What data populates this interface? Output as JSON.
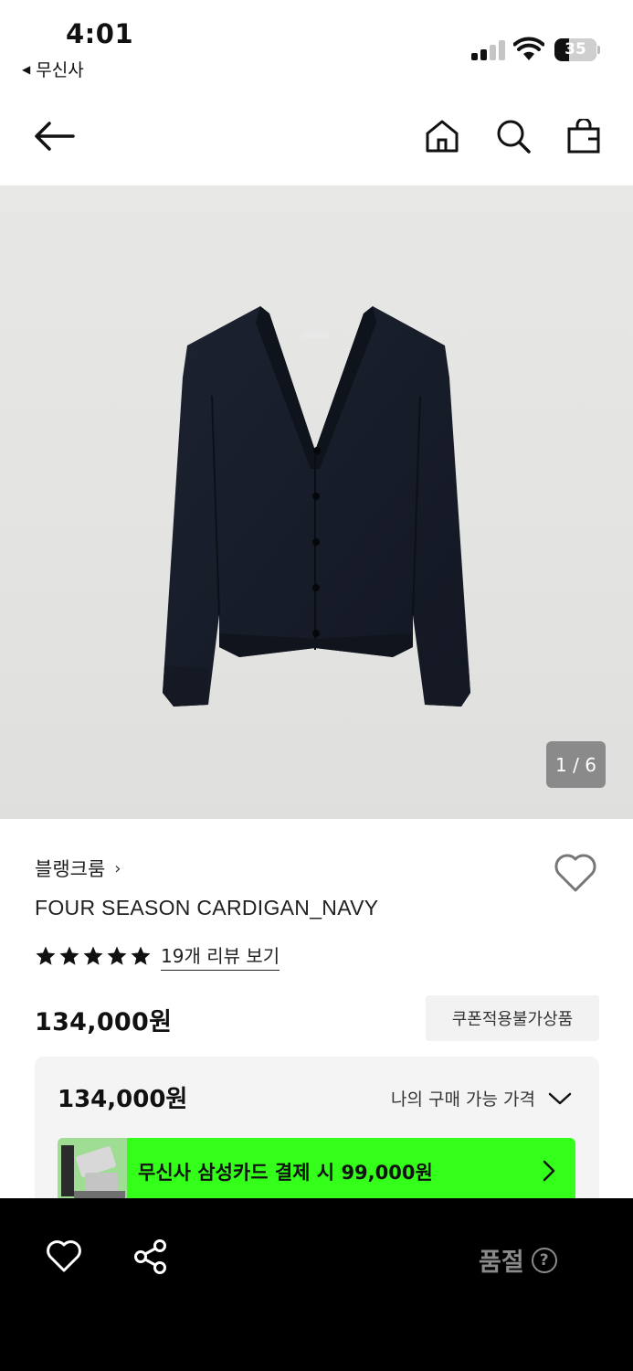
{
  "status_bar": {
    "time": "4:01",
    "back_app": "무신사",
    "battery_level": "35"
  },
  "nav": {
    "back_icon": "arrow-left-icon",
    "home_icon": "home-icon",
    "search_icon": "search-icon",
    "bag_icon": "shopping-bag-icon"
  },
  "gallery": {
    "indicator": "1 / 6",
    "current": 1,
    "total": 6
  },
  "product": {
    "brand": "블랭크룸",
    "brand_chevron": "›",
    "name": "FOUR SEASON CARDIGAN_NAVY",
    "rating_stars": 5,
    "review_link": "19개 리뷰 보기",
    "price": "134,000원",
    "coupon_badge": "쿠폰적용불가상품"
  },
  "price_card": {
    "price": "134,000원",
    "my_price_label": "나의 구매 가능 가격",
    "promo_text": "무신사 삼성카드 결제 시 99,000원"
  },
  "bottom_bar": {
    "soldout_label": "품절",
    "help_glyph": "?"
  },
  "colors": {
    "promo_green": "#33ff1a",
    "bottom_bar": "#000000",
    "garment_navy": "#171c26"
  }
}
